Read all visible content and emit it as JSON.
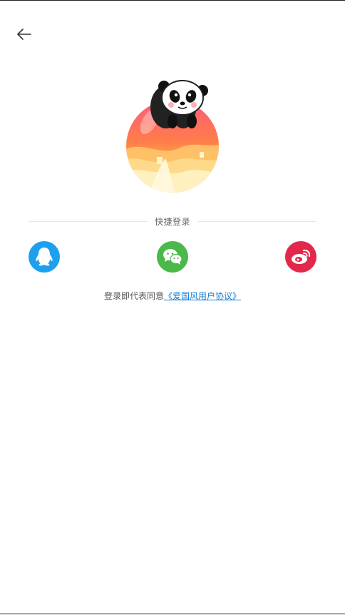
{
  "header": {
    "back_icon": "arrow-left-icon"
  },
  "logo": {
    "name": "panda-logo"
  },
  "quick_login": {
    "label": "快捷登录",
    "providers": [
      {
        "key": "qq",
        "icon": "qq-penguin-icon",
        "color": "#1fa0ef"
      },
      {
        "key": "wechat",
        "icon": "wechat-icon",
        "color": "#4bb84a"
      },
      {
        "key": "weibo",
        "icon": "weibo-icon",
        "color": "#e2294b"
      }
    ]
  },
  "agreement": {
    "prefix": "登录即代表同意",
    "link": "《爱国风用户协议》"
  }
}
